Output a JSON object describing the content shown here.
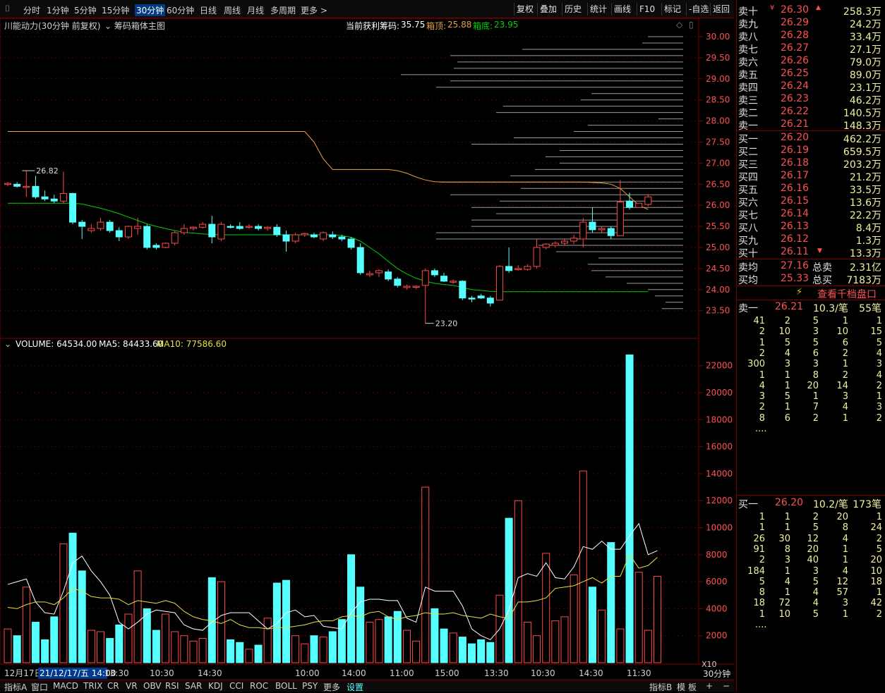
{
  "menu": {
    "items": [
      "分时",
      "1分钟",
      "5分钟",
      "15分钟",
      "30分钟",
      "60分钟",
      "日线",
      "周线",
      "月线",
      "多周期",
      "更多 >"
    ],
    "right_buttons": [
      "复权",
      "叠加",
      "历史",
      "统计",
      "画线",
      "F10",
      "标记",
      "-自选",
      "返回"
    ]
  },
  "info": {
    "stock": "川能动力(30分钟 前复权)",
    "indicator": "筹码箱体主图",
    "profit_label": "当前获利筹码:",
    "profit_value": "35.75",
    "top_label": "箱顶:",
    "top_value": "25.88",
    "bottom_label": "箱底:",
    "bottom_value": "23.95",
    "max_label": "26.82",
    "min_label": "23.20"
  },
  "volume": {
    "label": "VOLUME: 64534.00",
    "ma5": "MA5: 84433.60",
    "ma10": "MA10: 77586.60"
  },
  "price_axis": [
    "30.00",
    "29.50",
    "29.00",
    "28.50",
    "28.00",
    "27.50",
    "27.00",
    "26.50",
    "26.00",
    "25.50",
    "25.00",
    "24.50",
    "24.00",
    "23.50"
  ],
  "vol_axis": [
    "22000",
    "20000",
    "18000",
    "16000",
    "14000",
    "12000",
    "10000",
    "8000",
    "6000",
    "4000",
    "2000"
  ],
  "x_labels": [
    "12月17日",
    "21/12/17/五 14:00",
    "13:30",
    "10:30",
    "14:30",
    "10:00",
    "14:00",
    "11:00",
    "15:00",
    "13:30",
    "10:30",
    "14:30",
    "11:30"
  ],
  "x10": "X10",
  "period": "30分钟",
  "bottom": {
    "tabs": [
      "指标A",
      "窗口",
      "MACD",
      "TRIX",
      "CR",
      "VR",
      "OBV",
      "RSI",
      "SAR",
      "KDJ",
      "CCI",
      "ROC",
      "BOLL",
      "PSY",
      "更多",
      "设置"
    ],
    "right": [
      "指标B",
      "模",
      "板",
      "+",
      "−"
    ]
  },
  "colors": {
    "up": "#ff4a4a",
    "down": "#55ffff",
    "ma_green": "#00d000",
    "ma_orange": "#e8a040",
    "accent_red": "#7a0000"
  },
  "chart_data": {
    "type": "candlestick",
    "candles": [
      [
        26.5,
        26.55,
        26.45,
        26.52
      ],
      [
        26.5,
        26.55,
        26.42,
        26.45
      ],
      [
        26.45,
        26.82,
        26.2,
        26.45
      ],
      [
        26.45,
        26.7,
        26.15,
        26.2
      ],
      [
        26.2,
        26.35,
        26.1,
        26.15
      ],
      [
        26.15,
        26.25,
        26.05,
        26.1
      ],
      [
        26.1,
        26.8,
        26.05,
        26.28
      ],
      [
        26.28,
        26.3,
        25.55,
        25.6
      ],
      [
        25.6,
        25.65,
        25.2,
        25.5
      ],
      [
        25.4,
        25.55,
        25.35,
        25.45
      ],
      [
        25.45,
        25.7,
        25.4,
        25.6
      ],
      [
        25.6,
        25.65,
        25.35,
        25.4
      ],
      [
        25.4,
        25.48,
        25.15,
        25.25
      ],
      [
        25.25,
        25.52,
        25.2,
        25.5
      ],
      [
        25.45,
        25.7,
        25.3,
        25.5
      ],
      [
        25.5,
        25.55,
        24.95,
        25.0
      ],
      [
        25.05,
        25.1,
        24.95,
        25.0
      ],
      [
        25.0,
        25.12,
        24.98,
        25.1
      ],
      [
        25.1,
        25.4,
        25.05,
        25.35
      ],
      [
        25.35,
        25.55,
        25.3,
        25.45
      ],
      [
        25.45,
        25.5,
        25.4,
        25.48
      ],
      [
        25.48,
        25.6,
        25.45,
        25.55
      ],
      [
        25.55,
        25.75,
        25.1,
        25.25
      ],
      [
        25.2,
        25.6,
        25.15,
        25.55
      ],
      [
        25.5,
        25.55,
        25.45,
        25.48
      ],
      [
        25.5,
        25.6,
        25.42,
        25.45
      ],
      [
        25.48,
        25.55,
        25.45,
        25.5
      ],
      [
        25.5,
        25.55,
        25.4,
        25.45
      ],
      [
        25.45,
        25.5,
        25.4,
        25.48
      ],
      [
        25.48,
        25.55,
        25.25,
        25.3
      ],
      [
        25.3,
        25.4,
        24.9,
        25.15
      ],
      [
        25.15,
        25.35,
        25.1,
        25.3
      ],
      [
        25.3,
        25.35,
        25.25,
        25.33
      ],
      [
        25.3,
        25.35,
        25.22,
        25.25
      ],
      [
        25.2,
        25.38,
        25.15,
        25.35
      ],
      [
        25.3,
        25.38,
        25.2,
        25.25
      ],
      [
        25.25,
        25.3,
        25.15,
        25.2
      ],
      [
        25.2,
        25.25,
        24.95,
        25.0
      ],
      [
        25.0,
        25.1,
        24.35,
        24.4
      ],
      [
        24.35,
        24.45,
        24.3,
        24.38
      ],
      [
        24.4,
        24.48,
        24.3,
        24.45
      ],
      [
        24.42,
        24.48,
        24.2,
        24.25
      ],
      [
        24.25,
        24.3,
        24.05,
        24.1
      ],
      [
        24.05,
        24.12,
        24.0,
        24.08
      ],
      [
        24.06,
        24.1,
        24.02,
        24.08
      ],
      [
        24.1,
        24.5,
        23.2,
        24.45
      ],
      [
        24.45,
        24.5,
        24.3,
        24.35
      ],
      [
        24.32,
        24.4,
        24.18,
        24.2
      ],
      [
        24.2,
        24.24,
        24.14,
        24.2
      ],
      [
        24.2,
        24.22,
        23.75,
        23.8
      ],
      [
        23.8,
        23.85,
        23.7,
        23.78
      ],
      [
        23.85,
        23.9,
        23.78,
        23.8
      ],
      [
        23.8,
        23.85,
        23.6,
        23.68
      ],
      [
        23.75,
        24.58,
        23.75,
        24.55
      ],
      [
        24.55,
        25.0,
        24.4,
        24.45
      ],
      [
        24.5,
        24.58,
        24.45,
        24.5
      ],
      [
        24.48,
        24.6,
        24.45,
        24.55
      ],
      [
        24.55,
        25.2,
        24.5,
        25.0
      ],
      [
        25.0,
        25.1,
        24.95,
        25.08
      ],
      [
        25.05,
        25.15,
        25.0,
        25.1
      ],
      [
        25.1,
        25.2,
        25.05,
        25.15
      ],
      [
        25.15,
        25.3,
        25.08,
        25.22
      ],
      [
        25.2,
        25.7,
        25.0,
        25.6
      ],
      [
        25.6,
        25.95,
        25.35,
        25.42
      ],
      [
        25.42,
        25.5,
        25.35,
        25.45
      ],
      [
        25.45,
        25.5,
        25.2,
        25.28
      ],
      [
        25.28,
        26.6,
        25.28,
        26.08
      ],
      [
        26.1,
        26.3,
        25.9,
        25.95
      ],
      [
        25.95,
        26.05,
        25.95,
        26.05
      ],
      [
        26.02,
        26.25,
        25.98,
        26.2
      ]
    ],
    "ma": [
      26.05,
      26.05,
      26.05,
      26.05,
      26.05,
      26.05,
      26.05,
      26.05,
      26.03,
      25.98,
      25.93,
      25.87,
      25.8,
      25.72,
      25.64,
      25.56,
      25.5,
      25.45,
      25.4,
      25.36,
      25.34,
      25.32,
      25.31,
      25.3,
      25.3,
      25.3,
      25.3,
      25.3,
      25.3,
      25.3,
      25.3,
      25.3,
      25.3,
      25.3,
      25.3,
      25.3,
      25.28,
      25.24,
      25.15,
      25.0,
      24.85,
      24.67,
      24.5,
      24.37,
      24.27,
      24.2,
      24.15,
      24.12,
      24.1,
      24.05,
      24.0,
      23.98,
      23.96,
      23.95,
      23.95,
      23.95,
      23.95,
      23.95,
      23.95,
      23.95,
      23.95,
      23.95,
      23.95,
      23.95,
      23.95,
      23.95,
      23.95,
      23.95,
      23.95,
      23.95
    ],
    "cost": [
      27.75,
      27.75,
      27.75,
      27.75,
      27.75,
      27.75,
      27.75,
      27.75,
      27.75,
      27.75,
      27.75,
      27.75,
      27.75,
      27.75,
      27.75,
      27.75,
      27.75,
      27.75,
      27.75,
      27.75,
      27.75,
      27.75,
      27.75,
      27.75,
      27.75,
      27.75,
      27.75,
      27.75,
      27.75,
      27.75,
      27.75,
      27.75,
      27.75,
      27.5,
      27.1,
      26.85,
      26.85,
      26.85,
      26.85,
      26.85,
      26.85,
      26.85,
      26.82,
      26.76,
      26.67,
      26.6,
      26.56,
      26.55,
      26.55,
      26.55,
      26.55,
      26.55,
      26.55,
      26.55,
      26.55,
      26.55,
      26.55,
      26.55,
      26.55,
      26.55,
      26.55,
      26.55,
      26.55,
      26.54,
      26.53,
      26.5,
      26.4,
      26.2,
      26.0,
      25.9
    ],
    "volumes": [
      2500,
      2000,
      5600,
      3000,
      1700,
      3400,
      8800,
      9600,
      6800,
      2400,
      2300,
      1800,
      2800,
      3600,
      6800,
      4000,
      2400,
      3600,
      2300,
      2000,
      1600,
      1800,
      6300,
      6000,
      1700,
      1500,
      1000,
      1300,
      3300,
      5900,
      6100,
      2000,
      1400,
      2000,
      1900,
      2300,
      3200,
      8000,
      5600,
      3000,
      3200,
      3400,
      3800,
      2400,
      1600,
      13000,
      4000,
      2500,
      2200,
      1900,
      1400,
      1700,
      1500,
      5000,
      10700,
      12000,
      3000,
      2000,
      8100,
      3100,
      3400,
      6500,
      14200,
      5600,
      3900,
      8900,
      2500,
      22800,
      6700,
      2400,
      6400
    ],
    "ma5_vol": [
      5800,
      6000,
      6200,
      4500,
      3700,
      3600,
      5300,
      7400,
      7900,
      6800,
      6000,
      5000,
      3000,
      2500,
      3000,
      3600,
      3900,
      3800,
      3700,
      2800,
      2500,
      2400,
      3000,
      3500,
      3700,
      3700,
      3700,
      3100,
      2500,
      2900,
      3700,
      3900,
      3400,
      3500,
      2700,
      2600,
      2500,
      3700,
      4500,
      4700,
      4700,
      4600,
      4600,
      3300,
      3000,
      5600,
      5300,
      5300,
      5300,
      4200,
      2500,
      2000,
      1700,
      2500,
      3900,
      6300,
      6600,
      6400,
      7400,
      6300,
      6200,
      7100,
      8600,
      8400,
      9000,
      8400,
      8400,
      9400,
      10300,
      8000,
      8300
    ],
    "ma10_vol": [
      4100,
      4000,
      4300,
      4500,
      4500,
      4300,
      4800,
      5500,
      5300,
      4900,
      4800,
      4800,
      4700,
      4300,
      4600,
      4500,
      4400,
      4600,
      4400,
      3800,
      3400,
      3200,
      3100,
      2900,
      3200,
      2800,
      2600,
      2600,
      2500,
      2600,
      2600,
      2700,
      2800,
      3000,
      3100,
      3100,
      3400,
      3500,
      3400,
      3700,
      3800,
      3400,
      3200,
      3400,
      3500,
      3700,
      3600,
      3600,
      3700,
      3500,
      3400,
      3300,
      3600,
      3400,
      3300,
      4500,
      4500,
      4600,
      4800,
      5500,
      5600,
      5700,
      6000,
      6300,
      5900,
      6400,
      6400,
      8000,
      7000,
      7200,
      7800
    ],
    "chip_lengths": [
      [
        30.0,
        50
      ],
      [
        29.85,
        58
      ],
      [
        29.7,
        228
      ],
      [
        29.55,
        330
      ],
      [
        29.4,
        320
      ],
      [
        29.25,
        325
      ],
      [
        29.1,
        400
      ],
      [
        28.95,
        330
      ],
      [
        28.8,
        350
      ],
      [
        28.65,
        130
      ],
      [
        28.5,
        145
      ],
      [
        28.35,
        255
      ],
      [
        28.2,
        265
      ],
      [
        28.05,
        35
      ],
      [
        27.9,
        135
      ],
      [
        27.75,
        155
      ],
      [
        27.6,
        240
      ],
      [
        27.45,
        300
      ],
      [
        27.3,
        175
      ],
      [
        27.15,
        195
      ],
      [
        27.0,
        175
      ],
      [
        26.85,
        210
      ],
      [
        26.7,
        245
      ],
      [
        26.55,
        345
      ],
      [
        26.4,
        230
      ],
      [
        26.25,
        330
      ],
      [
        26.1,
        260
      ],
      [
        25.95,
        300
      ],
      [
        25.8,
        265
      ],
      [
        25.65,
        300
      ],
      [
        25.5,
        300
      ],
      [
        25.35,
        350
      ],
      [
        25.2,
        350
      ],
      [
        25.05,
        205
      ],
      [
        24.9,
        180
      ],
      [
        24.75,
        120
      ],
      [
        24.6,
        135
      ],
      [
        24.45,
        130
      ],
      [
        24.3,
        110
      ],
      [
        24.15,
        80
      ],
      [
        24.0,
        50
      ],
      [
        23.85,
        40
      ],
      [
        23.7,
        25
      ],
      [
        23.55,
        30
      ]
    ]
  },
  "order_book": {
    "asks": [
      [
        "卖十",
        "26.30",
        "258.3万"
      ],
      [
        "卖九",
        "26.29",
        "24.2万"
      ],
      [
        "卖八",
        "26.28",
        "33.4万"
      ],
      [
        "卖七",
        "26.27",
        "27.1万"
      ],
      [
        "卖六",
        "26.26",
        "79.0万"
      ],
      [
        "卖五",
        "26.25",
        "89.0万"
      ],
      [
        "卖四",
        "26.24",
        "23.1万"
      ],
      [
        "卖三",
        "26.23",
        "46.2万"
      ],
      [
        "卖二",
        "26.22",
        "140.5万"
      ],
      [
        "卖一",
        "26.21",
        "148.3万"
      ]
    ],
    "bids": [
      [
        "买一",
        "26.20",
        "462.2万"
      ],
      [
        "买二",
        "26.19",
        "659.5万"
      ],
      [
        "买三",
        "26.18",
        "203.2万"
      ],
      [
        "买四",
        "26.17",
        "21.2万"
      ],
      [
        "买五",
        "26.16",
        "33.5万"
      ],
      [
        "买六",
        "26.15",
        "13.6万"
      ],
      [
        "买七",
        "26.14",
        "22.2万"
      ],
      [
        "买八",
        "26.13",
        "8.4万"
      ],
      [
        "买九",
        "26.12",
        "1.3万"
      ],
      [
        "买十",
        "26.11",
        "13.3万"
      ]
    ],
    "ask_avg_label": "卖均",
    "ask_avg": "27.16",
    "total_sell_label": "总卖",
    "total_sell": "2.31亿",
    "bid_avg_label": "买均",
    "bid_avg": "25.33",
    "total_buy_label": "总买",
    "total_buy": "7183万",
    "view_link": "查看千档盘口",
    "q1": {
      "label": "卖一",
      "price": "26.21",
      "avg": "10.3/笔",
      "count": "55笔",
      "rows": [
        [
          "41",
          "2",
          "5",
          "1",
          "1"
        ],
        [
          "2",
          "10",
          "3",
          "10",
          "15"
        ],
        [
          "1",
          "5",
          "5",
          "6",
          "5"
        ],
        [
          "2",
          "4",
          "6",
          "2",
          "4"
        ],
        [
          "300",
          "3",
          "3",
          "1",
          "3"
        ],
        [
          "1",
          "1",
          "8",
          "2",
          "4"
        ],
        [
          "4",
          "1",
          "20",
          "14",
          "2"
        ],
        [
          "3",
          "5",
          "1",
          "3",
          "1"
        ],
        [
          "2",
          "1",
          "7",
          "4",
          "3"
        ],
        [
          "8",
          "6",
          "2",
          "1",
          "2"
        ],
        [
          "....",
          "",
          "",
          "",
          ""
        ]
      ]
    },
    "q2": {
      "label": "买一",
      "price": "26.20",
      "avg": "10.2/笔",
      "count": "173笔",
      "rows": [
        [
          "1",
          "1",
          "2",
          "20",
          "1"
        ],
        [
          "1",
          "1",
          "5",
          "8",
          "24"
        ],
        [
          "26",
          "30",
          "12",
          "4",
          "2"
        ],
        [
          "91",
          "8",
          "20",
          "1",
          "5"
        ],
        [
          "2",
          "3",
          "40",
          "1",
          "20"
        ],
        [
          "184",
          "1",
          "3",
          "4",
          "10"
        ],
        [
          "5",
          "4",
          "5",
          "12",
          "18"
        ],
        [
          "8",
          "1",
          "4",
          "57",
          "1"
        ],
        [
          "18",
          "72",
          "4",
          "3",
          "42"
        ],
        [
          "1",
          "10",
          "5",
          "1",
          "2"
        ],
        [
          "....",
          "",
          "",
          "",
          ""
        ]
      ]
    }
  }
}
